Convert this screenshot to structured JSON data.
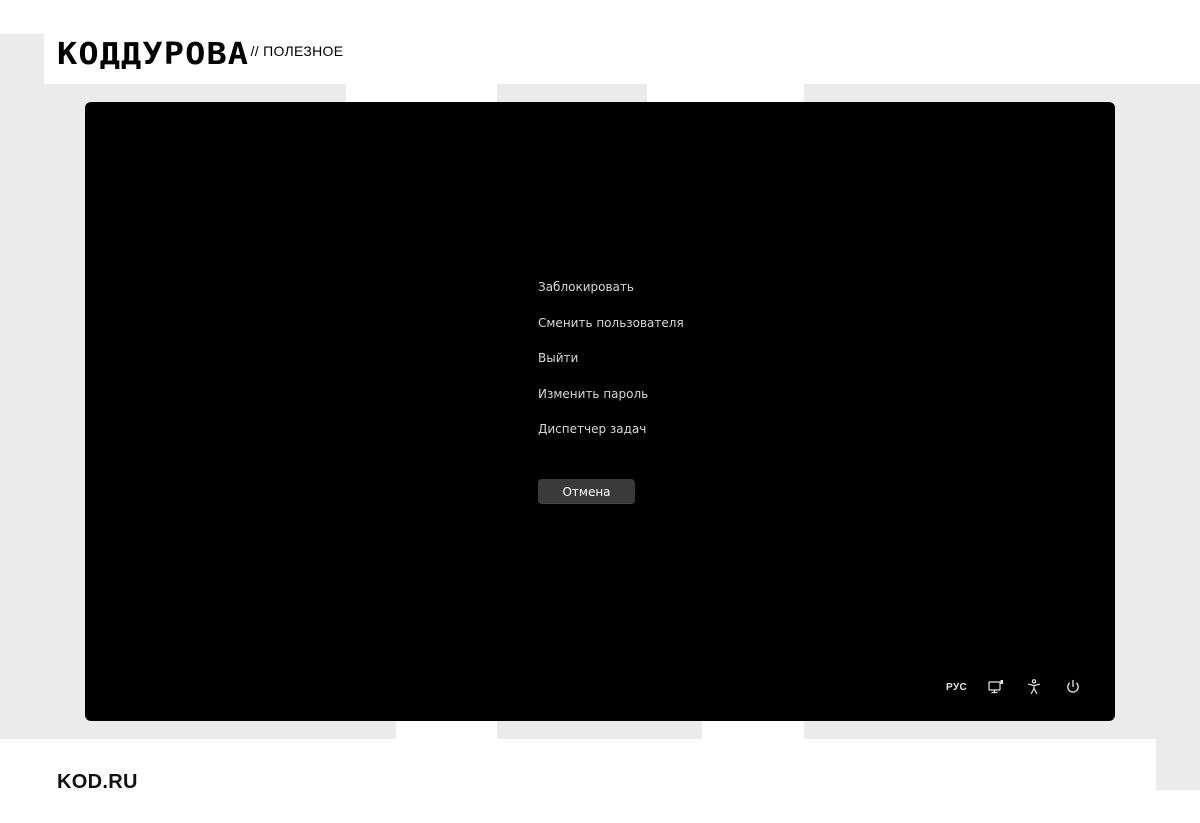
{
  "header": {
    "logo_text": "КОДДУРОВА",
    "section_label": "// ПОЛЕЗНОЕ"
  },
  "security_screen": {
    "menu": [
      {
        "label": "Заблокировать"
      },
      {
        "label": "Сменить пользователя"
      },
      {
        "label": "Выйти"
      },
      {
        "label": "Изменить пароль"
      },
      {
        "label": "Диспетчер задач"
      }
    ],
    "cancel_label": "Отмена",
    "tray": {
      "language": "РУС",
      "icons": [
        "network-icon",
        "accessibility-icon",
        "power-icon"
      ]
    }
  },
  "footer": {
    "site": "KOD.RU"
  },
  "colors": {
    "page_background": "#ffffff",
    "decor_blocks": "#ebebeb",
    "screen_background": "#000000",
    "menu_text": "#d8d8d8",
    "button_background": "#3a3a3a"
  }
}
